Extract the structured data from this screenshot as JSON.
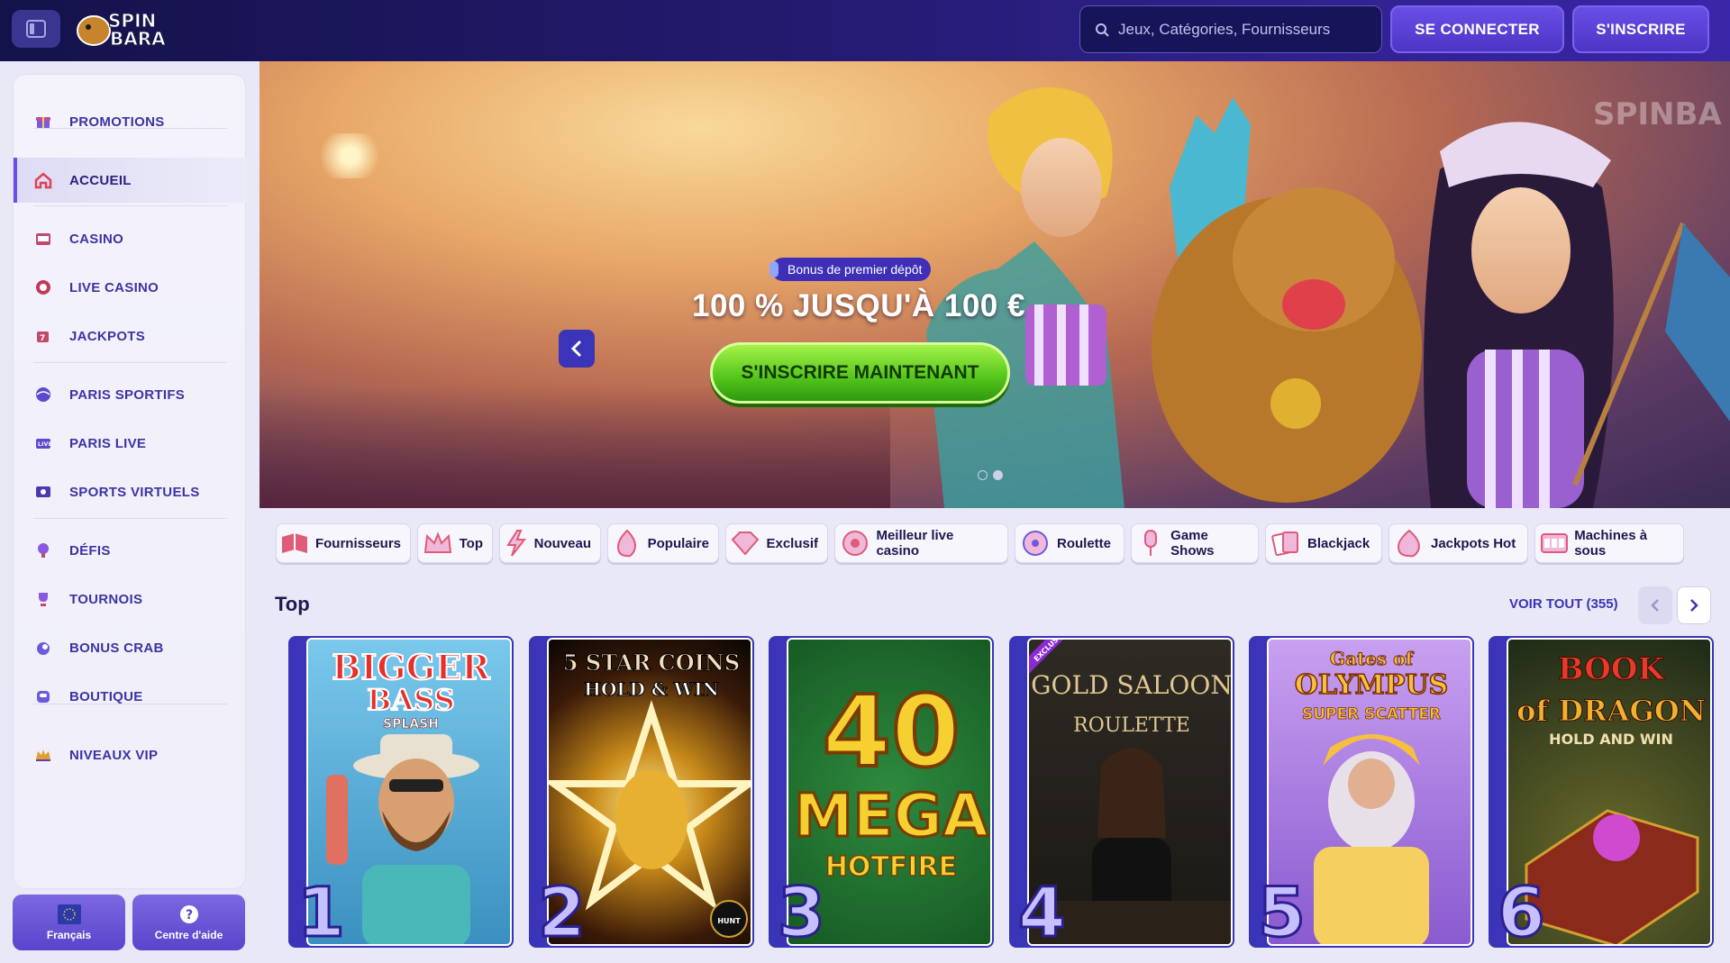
{
  "header": {
    "search_placeholder": "Jeux, Catégories, Fournisseurs",
    "login_label": "SE CONNECTER",
    "register_label": "S'INSCRIRE",
    "logo_text": "SPIN BARA"
  },
  "sidebar": {
    "items": [
      {
        "label": "PROMOTIONS",
        "icon": "gift-icon"
      },
      {
        "label": "ACCUEIL",
        "icon": "home-icon"
      },
      {
        "label": "CASINO",
        "icon": "slot-machine-icon"
      },
      {
        "label": "LIVE CASINO",
        "icon": "roulette-chip-icon"
      },
      {
        "label": "JACKPOTS",
        "icon": "jackpot-icon"
      },
      {
        "label": "PARIS SPORTIFS",
        "icon": "ball-icon"
      },
      {
        "label": "PARIS LIVE",
        "icon": "live-screen-icon"
      },
      {
        "label": "SPORTS VIRTUELS",
        "icon": "virtual-sports-icon"
      },
      {
        "label": "DÉFIS",
        "icon": "challenge-icon"
      },
      {
        "label": "TOURNOIS",
        "icon": "trophy-icon"
      },
      {
        "label": "BONUS CRAB",
        "icon": "crab-icon"
      },
      {
        "label": "BOUTIQUE",
        "icon": "shop-icon"
      },
      {
        "label": "NIVEAUX VIP",
        "icon": "crown-icon"
      }
    ],
    "language_label": "Français",
    "help_label": "Centre d'aide"
  },
  "hero": {
    "badge": "Bonus de premier dépôt",
    "title": "100 % JUSQU'À 100 €",
    "cta": "S'INSCRIRE MAINTENANT",
    "watermark": "SPINBA"
  },
  "categories": [
    "Fournisseurs",
    "Top",
    "Nouveau",
    "Populaire",
    "Exclusif",
    "Meilleur live casino",
    "Roulette",
    "Game Shows",
    "Blackjack",
    "Jackpots Hot",
    "Machines à sous"
  ],
  "top_section": {
    "title": "Top",
    "see_all": "VOIR TOUT (355)",
    "games": [
      {
        "rank": "1",
        "title_line1": "BIGGER",
        "title_line2": "BASS",
        "title_line3": "SPLASH",
        "color": "#5fb4e0"
      },
      {
        "rank": "2",
        "title_line1": "5 STAR COINS",
        "title_line2": "HOLD & WIN",
        "title_line3": "",
        "color": "#1a1208"
      },
      {
        "rank": "3",
        "title_line1": "40",
        "title_line2": "MEGA",
        "title_line3": "HOTFIRE",
        "color": "#1e6a30"
      },
      {
        "rank": "4",
        "title_line1": "GOLD SALOON",
        "title_line2": "ROULETTE",
        "title_line3": "EXCLUSIVE",
        "color": "#2a2620"
      },
      {
        "rank": "5",
        "title_line1": "Gates of",
        "title_line2": "OLYMPUS",
        "title_line3": "SUPER SCATTER",
        "color": "#8a5ad0"
      },
      {
        "rank": "6",
        "title_line1": "BOOK",
        "title_line2": "of DRAGON",
        "title_line3": "HOLD AND WIN",
        "color": "#2e3a20"
      }
    ]
  }
}
